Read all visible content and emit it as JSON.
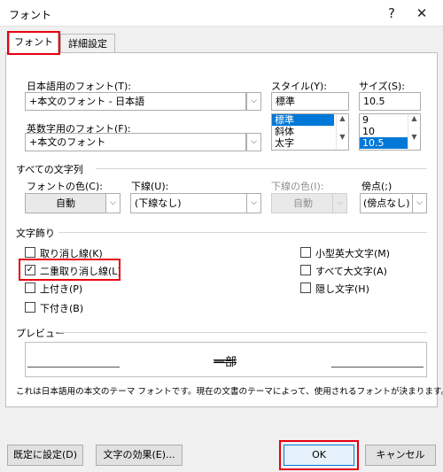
{
  "window": {
    "title": "フォント",
    "help": "?",
    "close": "✕"
  },
  "tabs": [
    {
      "label": "フォント"
    },
    {
      "label": "詳細設定"
    }
  ],
  "font": {
    "jp_label": "日本語用のフォント(T):",
    "jp_value": "+本文のフォント - 日本語",
    "en_label": "英数字用のフォント(F):",
    "en_value": "+本文のフォント",
    "style_label": "スタイル(Y):",
    "style_value": "標準",
    "style_options": [
      "標準",
      "斜体",
      "太字"
    ],
    "size_label": "サイズ(S):",
    "size_value": "10.5",
    "size_options": [
      "9",
      "10",
      "10.5"
    ]
  },
  "all_text": {
    "section": "すべての文字列",
    "color_label": "フォントの色(C):",
    "color_value": "自動",
    "underline_label": "下線(U):",
    "underline_value": "(下線なし)",
    "underline_color_label": "下線の色(I):",
    "underline_color_value": "自動",
    "emphasis_label": "傍点(;)",
    "emphasis_value": "(傍点なし)"
  },
  "effects": {
    "section": "文字飾り",
    "left": [
      {
        "label": "取り消し線(K)",
        "checked": false
      },
      {
        "label": "二重取り消し線(L)",
        "checked": true
      },
      {
        "label": "上付き(P)",
        "checked": false
      },
      {
        "label": "下付き(B)",
        "checked": false
      }
    ],
    "right": [
      {
        "label": "小型英大文字(M)",
        "checked": false
      },
      {
        "label": "すべて大文字(A)",
        "checked": false
      },
      {
        "label": "隠し文字(H)",
        "checked": false
      }
    ]
  },
  "preview": {
    "section": "プレビュー",
    "sample": "一部",
    "description": "これは日本語用の本文のテーマ フォントです。現在の文書のテーマによって、使用されるフォントが決まります。"
  },
  "buttons": {
    "default": "既定に設定(D)",
    "text_effects": "文字の効果(E)...",
    "ok": "OK",
    "cancel": "キャンセル"
  },
  "icons": {
    "check": "✓",
    "arrow_down": "⌵",
    "arrow_up": "▲",
    "arrow_down_small": "▼"
  }
}
